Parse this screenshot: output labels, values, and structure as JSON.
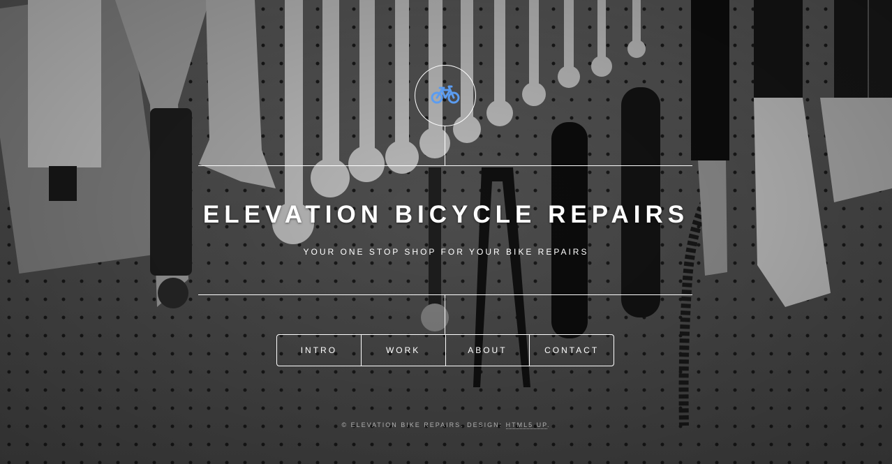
{
  "header": {
    "logo_icon": "bicycle-icon",
    "title": "ELEVATION BICYCLE REPAIRS",
    "subtitle": "YOUR ONE STOP SHOP FOR YOUR BIKE REPAIRS"
  },
  "nav": {
    "items": [
      {
        "label": "INTRO"
      },
      {
        "label": "WORK"
      },
      {
        "label": "ABOUT"
      },
      {
        "label": "CONTACT"
      }
    ]
  },
  "footer": {
    "copyright": "© ELEVATION BIKE REPAIRS. DESIGN: ",
    "credit_link": "HTML5 UP",
    "period": "."
  },
  "colors": {
    "text": "#ffffff",
    "icon_accent": "#5b9cf0",
    "background": "#555555"
  }
}
